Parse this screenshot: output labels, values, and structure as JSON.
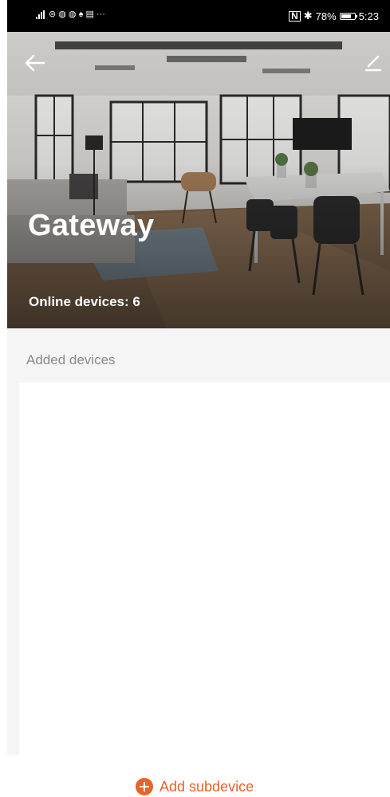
{
  "status_bar": {
    "left_glyphs": "⊜ ◍ ◍ ♠ ▤ ···",
    "nfc": "N",
    "bluetooth": "✱",
    "battery_percent": "78%",
    "battery_level": 0.78,
    "time": "5:23"
  },
  "header": {
    "back_icon": "arrow-left",
    "edit_icon": "pencil",
    "title": "Gateway",
    "online_devices_text": "Online devices: 6"
  },
  "devices": {
    "section_label": "Added devices",
    "items": []
  },
  "footer": {
    "add_icon": "plus-circle",
    "add_label": "Add subdevice",
    "accent_color": "#e8622c"
  }
}
